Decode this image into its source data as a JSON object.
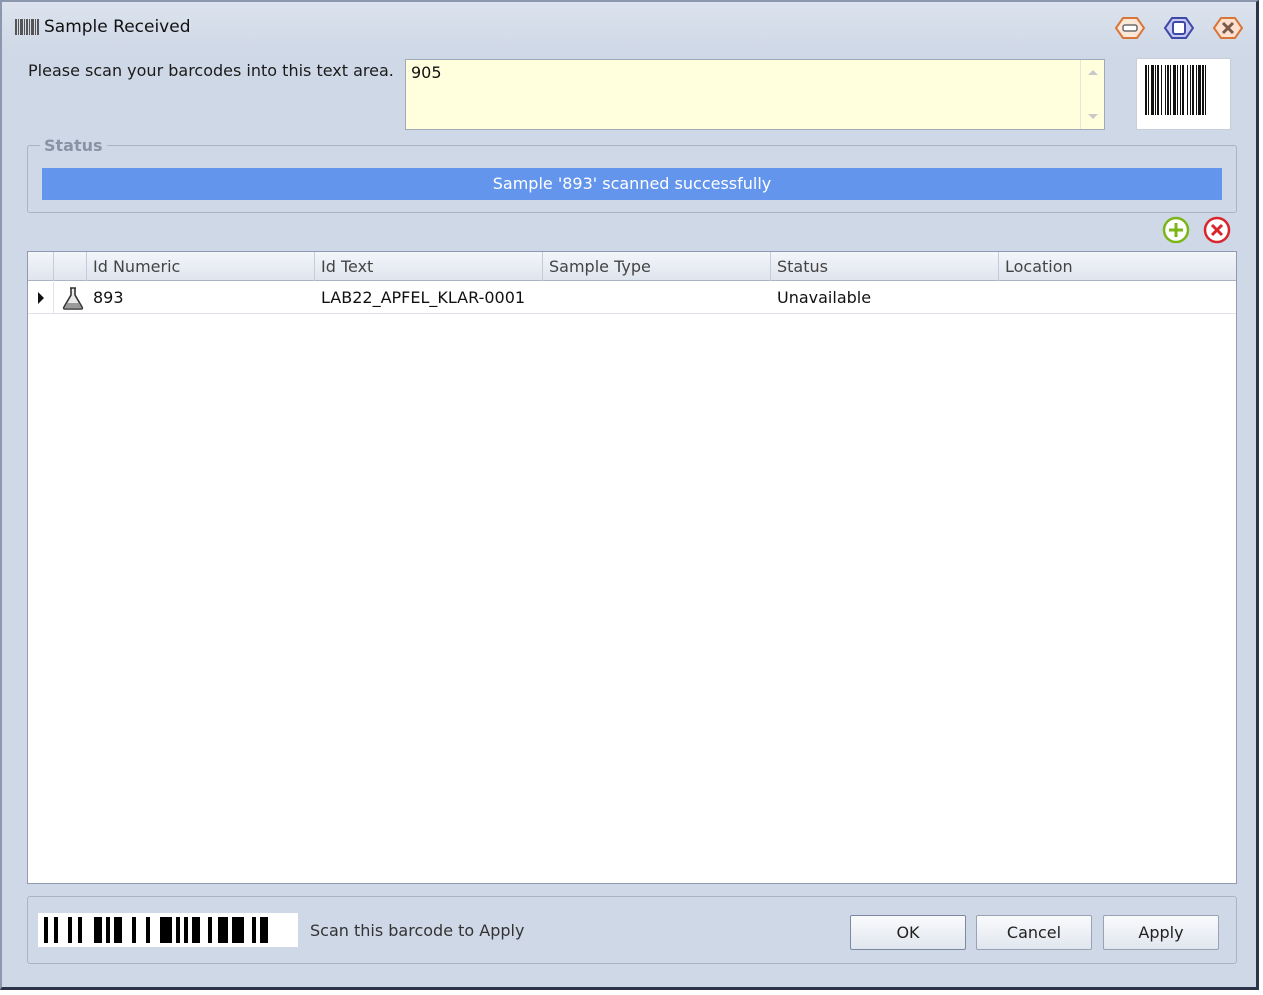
{
  "window": {
    "title": "Sample Received",
    "title_icon": "barcode-icon",
    "controls": [
      "minimize-icon",
      "maximize-icon",
      "close-icon"
    ]
  },
  "scan": {
    "label": "Please scan your barcodes into this text area.",
    "value": "905"
  },
  "status": {
    "legend": "Status",
    "message": "Sample '893' scanned successfully",
    "bar_color": "#6495ed"
  },
  "grid": {
    "columns": [
      "Id Numeric",
      "Id Text",
      "Sample Type",
      "Status",
      "Location"
    ],
    "rows": [
      {
        "icon": "flask-icon",
        "id_numeric": "893",
        "id_text": "LAB22_APFEL_KLAR-0001",
        "sample_type": "",
        "status": "Unavailable",
        "location": ""
      }
    ]
  },
  "footer": {
    "apply_hint": "Scan this barcode to Apply",
    "ok_label": "OK",
    "cancel_label": "Cancel",
    "apply_label": "Apply"
  },
  "colors": {
    "add": "#7cb518",
    "remove": "#d9262c"
  }
}
